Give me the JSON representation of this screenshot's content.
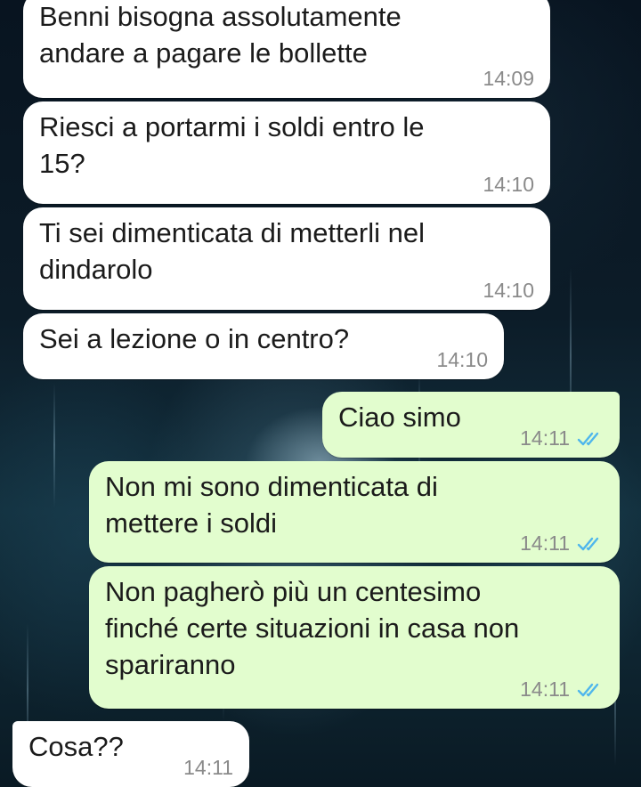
{
  "colors": {
    "incoming_bubble": "#ffffff",
    "outgoing_bubble": "#e2fdce",
    "read_ticks": "#4fb6ec",
    "timestamp": "#8a8a8a"
  },
  "messages": [
    {
      "direction": "incoming",
      "text": "Benni bisogna assolutamente\nandare a pagare le bollette",
      "time": "14:09"
    },
    {
      "direction": "incoming",
      "text": "Riesci a portarmi i soldi entro le\n15?",
      "time": "14:10"
    },
    {
      "direction": "incoming",
      "text": "Ti sei dimenticata di metterli nel\ndindarolo",
      "time": "14:10"
    },
    {
      "direction": "incoming",
      "text": "Sei a lezione o in centro?",
      "time": "14:10"
    },
    {
      "direction": "outgoing",
      "text": "Ciao simo",
      "time": "14:11",
      "status_icon": "double-check-read-icon"
    },
    {
      "direction": "outgoing",
      "text": "Non mi sono dimenticata di\nmettere i soldi",
      "time": "14:11",
      "status_icon": "double-check-read-icon"
    },
    {
      "direction": "outgoing",
      "text": "Non pagherò più un centesimo\nfinché certe situazioni in casa non\nspariranno",
      "time": "14:11",
      "status_icon": "double-check-read-icon"
    },
    {
      "direction": "incoming",
      "text": "Cosa??",
      "time": "14:11"
    }
  ]
}
